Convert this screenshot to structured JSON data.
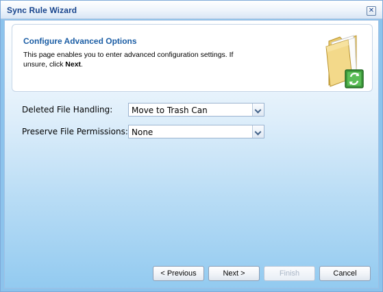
{
  "window": {
    "title": "Sync Rule Wizard",
    "close_icon": "close-icon"
  },
  "header": {
    "title": "Configure Advanced Options",
    "description_prefix": "This page enables you to enter advanced configuration settings. If unsure, click ",
    "description_emphasis": "Next",
    "description_suffix": ".",
    "icon": "folder-sync-icon"
  },
  "fields": [
    {
      "label": "Deleted File Handling:",
      "value": "Move to Trash Can"
    },
    {
      "label": "Preserve File Permissions:",
      "value": "None"
    }
  ],
  "buttons": {
    "previous": "< Previous",
    "next": "Next >",
    "finish": "Finish",
    "cancel": "Cancel"
  },
  "colors": {
    "title_text": "#15428b",
    "header_title": "#1c5ea5",
    "background": "#8cc3ec"
  }
}
